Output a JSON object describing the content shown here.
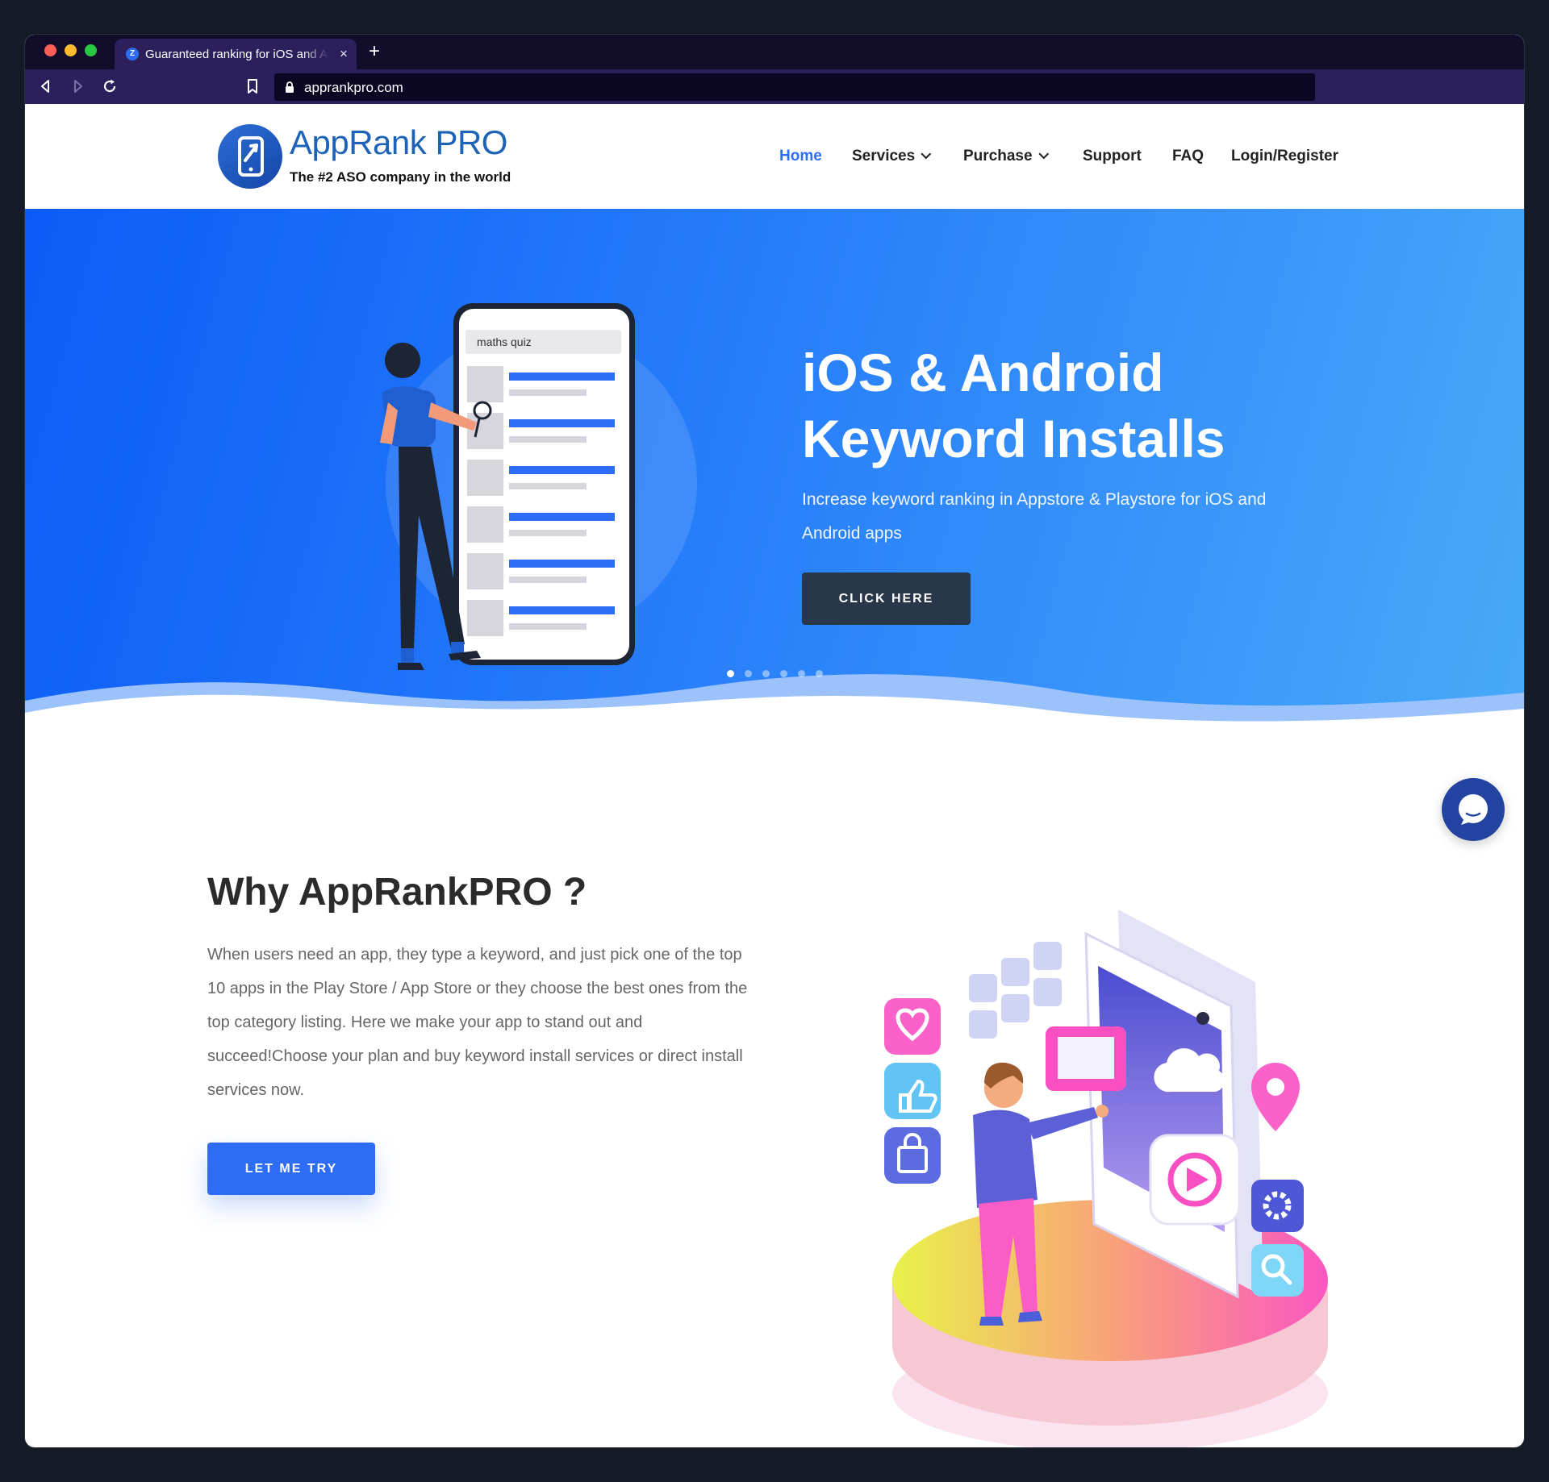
{
  "browser": {
    "tab_title": "Guaranteed ranking for iOS and Android",
    "tab_favicon": "Z",
    "url": "apprankpro.com",
    "close_label": "×",
    "new_tab_label": "+"
  },
  "header": {
    "logo_title": "AppRank PRO",
    "logo_tagline": "The #2 ASO company in the world",
    "nav": [
      {
        "label": "Home",
        "active": true
      },
      {
        "label": "Services"
      },
      {
        "label": "Purchase"
      },
      {
        "label": "Support"
      },
      {
        "label": "FAQ"
      },
      {
        "label": "Login/Register"
      }
    ]
  },
  "hero": {
    "title_line1": "iOS & Android",
    "title_line2": "Keyword Installs",
    "subtitle": "Increase keyword ranking in Appstore & Playstore for iOS and Android apps",
    "button": "CLICK HERE",
    "search_text": "maths quiz",
    "slide_count": 6,
    "active_slide": 1
  },
  "why": {
    "title": "Why AppRankPRO ?",
    "text": "When users need an app, they type a keyword, and just pick one of the top 10 apps in the Play Store / App Store or they choose the best ones from the top category listing. Here we make your app to stand out and succeed!Choose your plan and buy keyword install services or direct install services now.",
    "button": "LET ME TRY"
  },
  "colors": {
    "brand_blue": "#2d6cf5",
    "dark_button": "#28384a",
    "chat_blue": "#2244a0"
  },
  "icons": [
    "back-icon",
    "forward-icon",
    "reload-icon",
    "bookmark-icon",
    "lock-icon",
    "chat-icon",
    "phone-arrow-logo-icon",
    "heart-icon",
    "thumbs-up-icon",
    "shopping-bag-icon",
    "location-pin-icon",
    "gear-icon",
    "search-icon",
    "play-icon",
    "mail-icon",
    "cloud-icon"
  ]
}
